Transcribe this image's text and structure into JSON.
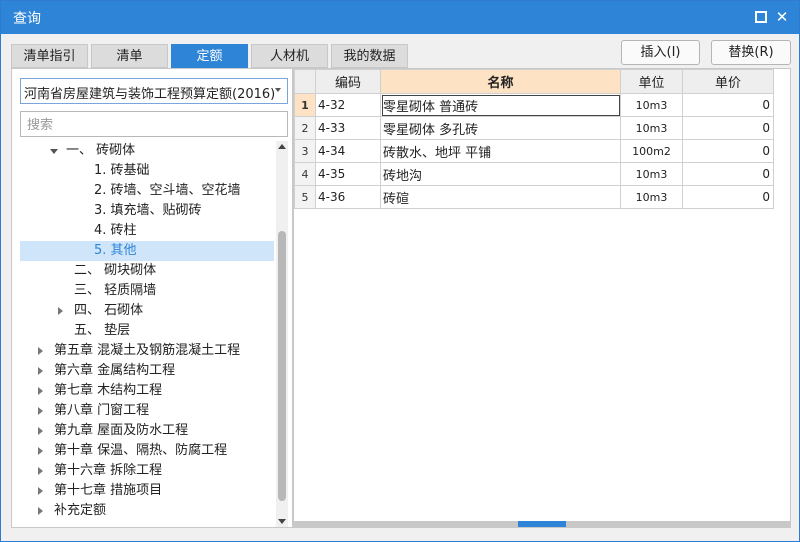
{
  "window": {
    "title": "查询"
  },
  "tabs": [
    {
      "label": "清单指引"
    },
    {
      "label": "清单"
    },
    {
      "label": "定额"
    },
    {
      "label": "人材机"
    },
    {
      "label": "我的数据"
    }
  ],
  "active_tab": "定额",
  "buttons": {
    "insert": "插入(I)",
    "replace": "替换(R)"
  },
  "left": {
    "quota_book": "河南省房屋建筑与装饰工程预算定额(2016)",
    "search_placeholder": "搜索",
    "tree": [
      {
        "label": "一、 砖砌体",
        "state": "expanded"
      },
      {
        "label": "1. 砖基础"
      },
      {
        "label": "2. 砖墙、空斗墙、空花墙"
      },
      {
        "label": "3. 填充墙、贴砌砖"
      },
      {
        "label": "4. 砖柱"
      },
      {
        "label": "5. 其他",
        "selected": true
      },
      {
        "label": "二、 砌块砌体"
      },
      {
        "label": "三、 轻质隔墙"
      },
      {
        "label": "四、 石砌体",
        "state": "collapsed"
      },
      {
        "label": "五、 垫层"
      },
      {
        "label": "第五章 混凝土及钢筋混凝土工程",
        "state": "collapsed"
      },
      {
        "label": "第六章 金属结构工程",
        "state": "collapsed"
      },
      {
        "label": "第七章 木结构工程",
        "state": "collapsed"
      },
      {
        "label": "第八章 门窗工程",
        "state": "collapsed"
      },
      {
        "label": "第九章 屋面及防水工程",
        "state": "collapsed"
      },
      {
        "label": "第十章 保温、隔热、防腐工程",
        "state": "collapsed"
      },
      {
        "label": "第十六章 拆除工程",
        "state": "collapsed"
      },
      {
        "label": "第十七章 措施项目",
        "state": "collapsed"
      },
      {
        "label": "补充定额",
        "state": "collapsed"
      }
    ]
  },
  "table": {
    "headers": {
      "code": "编码",
      "name": "名称",
      "unit": "单位",
      "price": "单价"
    },
    "rows": [
      {
        "n": "1",
        "code": "4-32",
        "name": "零星砌体 普通砖",
        "unit": "10m3",
        "price": "0"
      },
      {
        "n": "2",
        "code": "4-33",
        "name": "零星砌体 多孔砖",
        "unit": "10m3",
        "price": "0"
      },
      {
        "n": "3",
        "code": "4-34",
        "name": "砖散水、地坪 平铺",
        "unit": "100m2",
        "price": "0"
      },
      {
        "n": "4",
        "code": "4-35",
        "name": "砖地沟",
        "unit": "10m3",
        "price": "0"
      },
      {
        "n": "5",
        "code": "4-36",
        "name": "砖碹",
        "unit": "10m3",
        "price": "0"
      }
    ]
  },
  "colors": {
    "accent": "#2e84d6",
    "header_highlight": "#fde2c4",
    "tree_selected_bg": "#cfe6fa"
  }
}
